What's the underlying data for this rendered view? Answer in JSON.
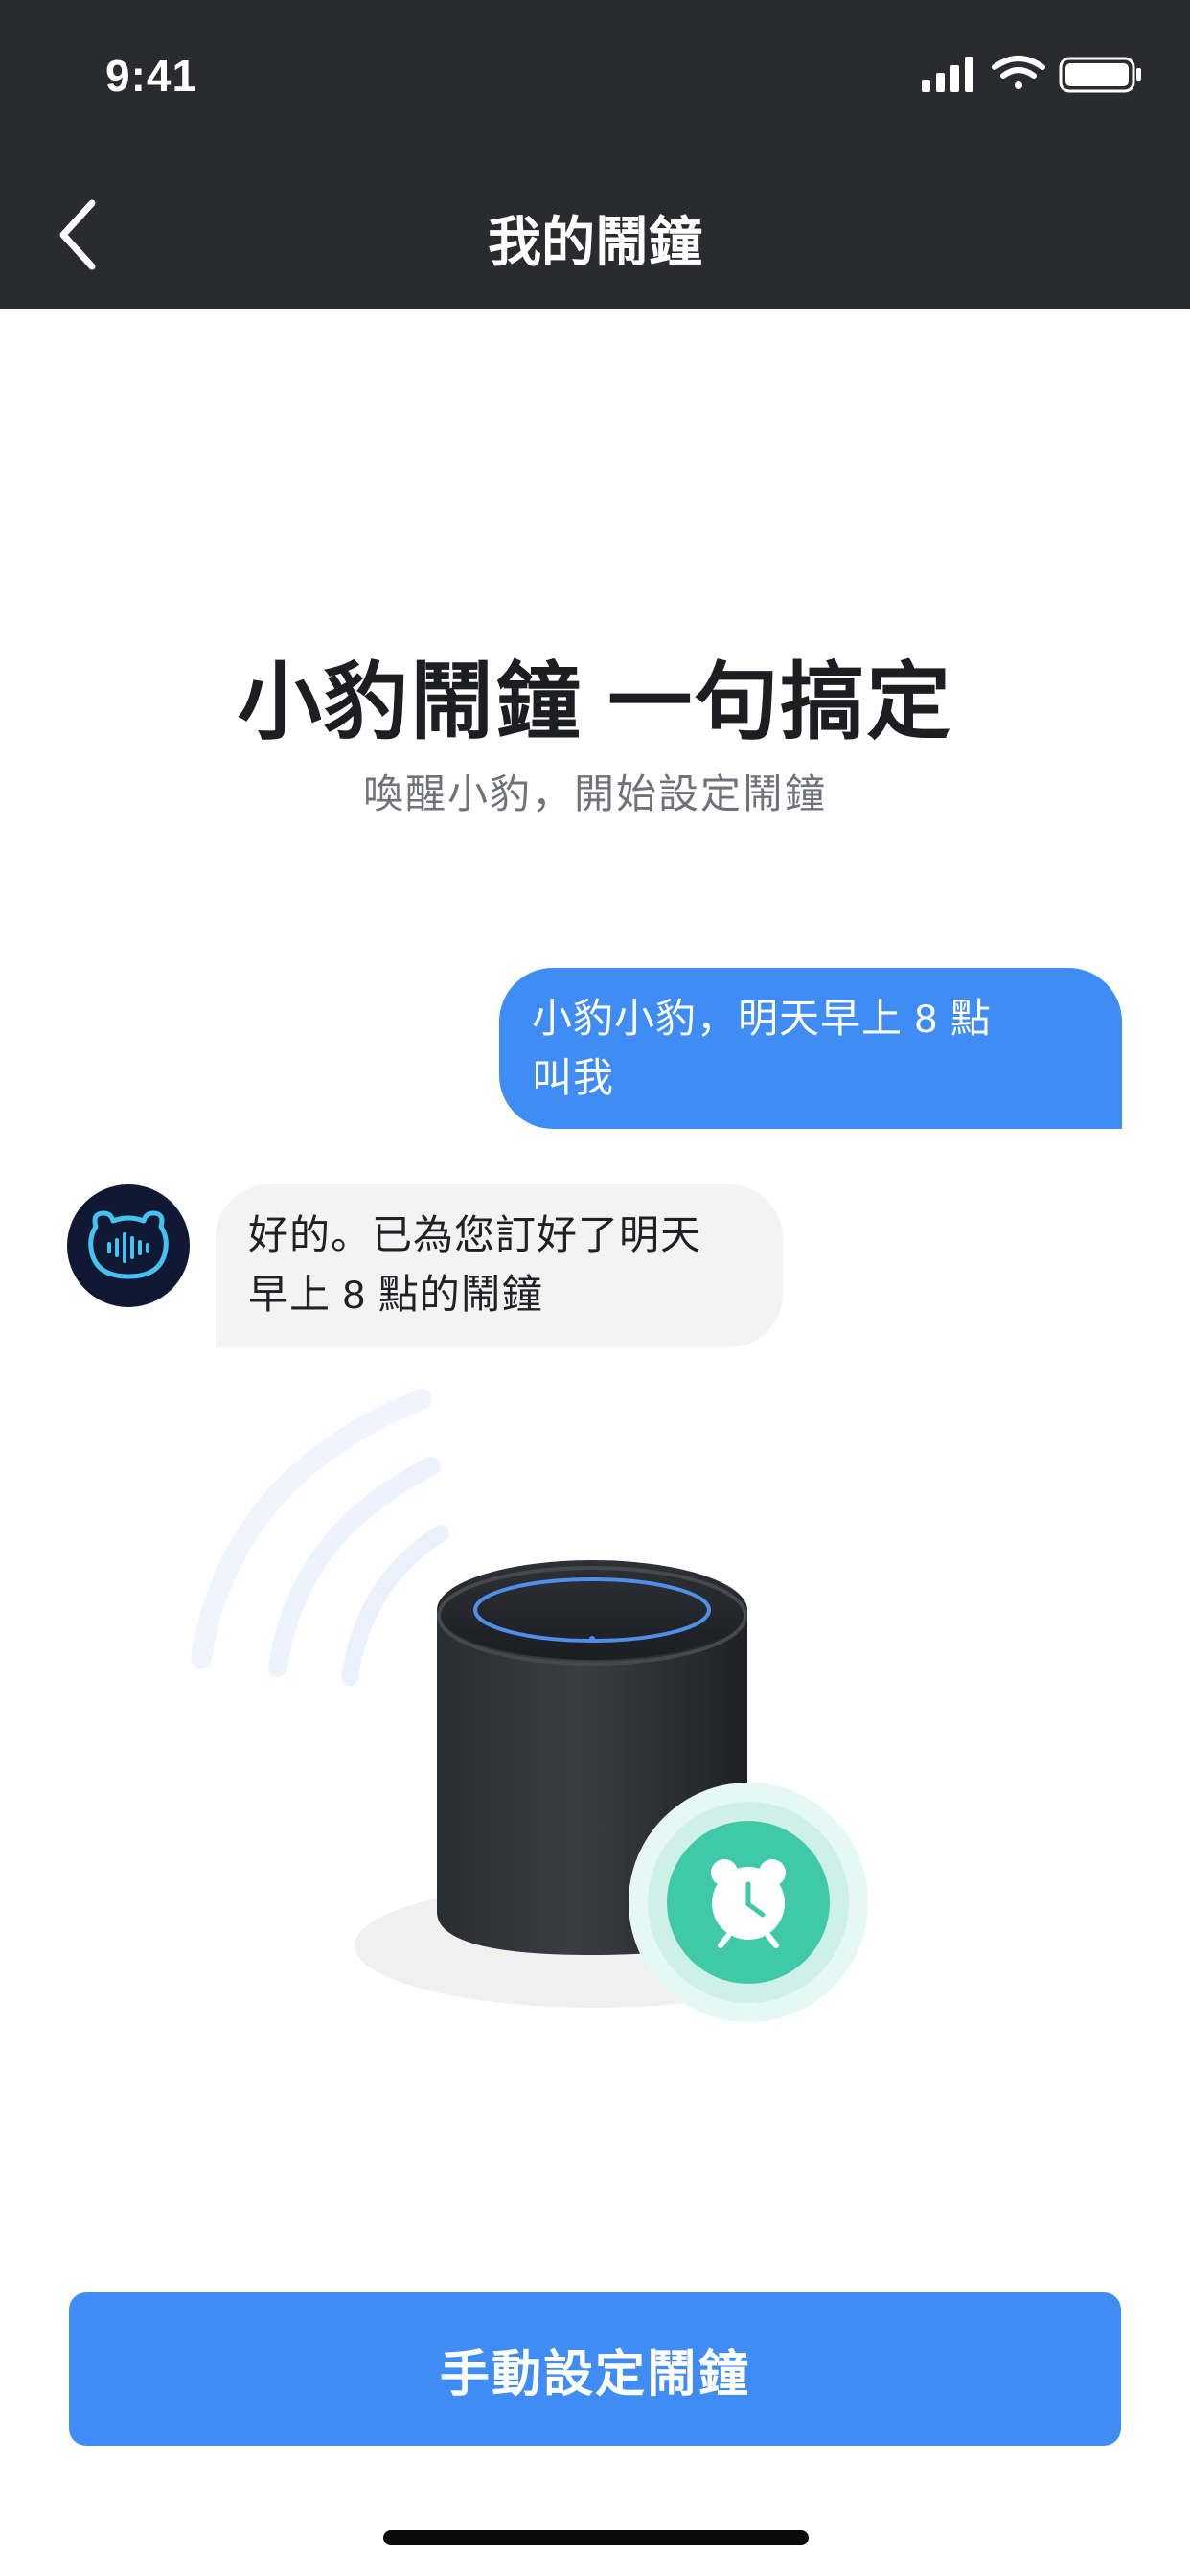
{
  "status_bar": {
    "time": "9:41"
  },
  "nav": {
    "title": "我的鬧鐘",
    "back_icon": "chevron-left-icon"
  },
  "hero": {
    "title": "小豹鬧鐘 一句搞定",
    "subtitle": "喚醒小豹，開始設定鬧鐘"
  },
  "chat": {
    "user_line1": "小豹小豹，明天早上 8 點",
    "user_line2": "叫我",
    "bot_line1": "好的。已為您訂好了明天",
    "bot_line2": "早上 8 點的鬧鐘"
  },
  "illustration": {
    "speaker": "smart-speaker",
    "alarm_icon": "alarm-clock-icon"
  },
  "actions": {
    "manual_button": "手動設定鬧鐘"
  },
  "colors": {
    "accent": "#3f8cf5",
    "dark_bar": "#292b2f",
    "teal": "#3fc9a9",
    "avatar_bg": "#101833"
  }
}
